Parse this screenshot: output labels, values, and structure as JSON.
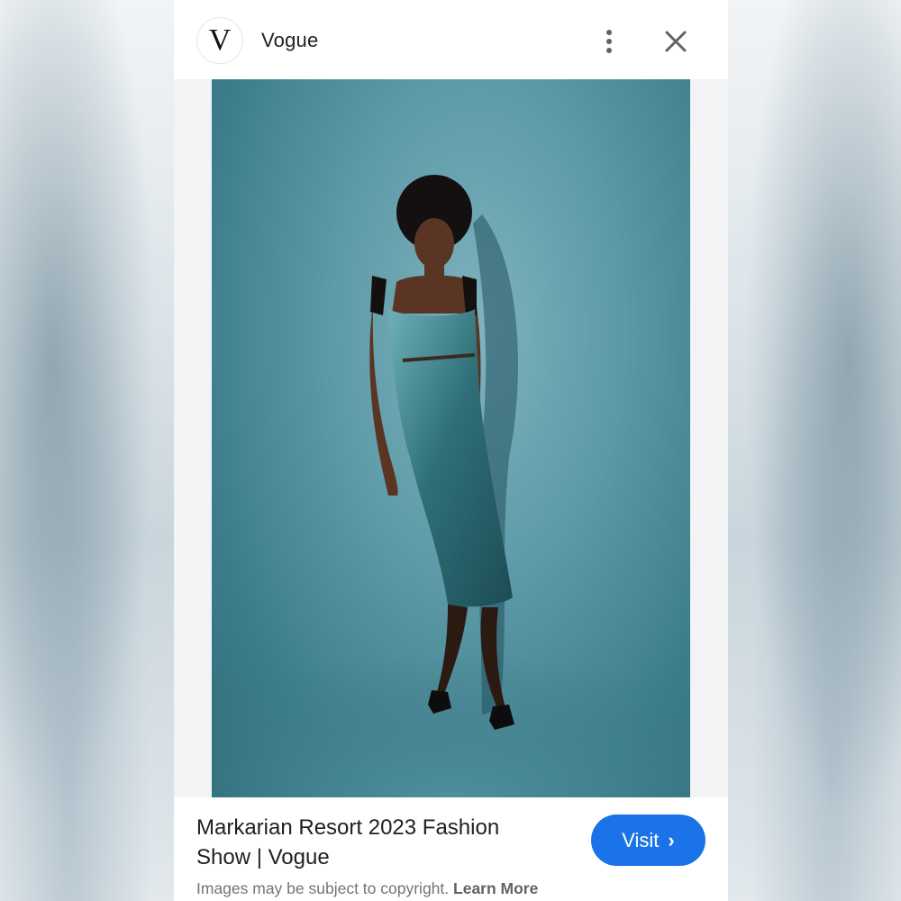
{
  "header": {
    "logo_letter": "V",
    "source_name": "Vogue",
    "more_icon": "more-vert-icon",
    "close_icon": "close-icon"
  },
  "image": {
    "alt": "Markarian Resort 2023 Fashion Show | Vogue"
  },
  "footer": {
    "caption": "Markarian Resort 2023 Fashion Show | Vogue",
    "visit_label": "Visit",
    "visit_icon": "chevron-right-icon",
    "copyright_text": "Images may be subject to copyright.",
    "learn_more_label": "Learn More"
  },
  "colors": {
    "accent": "#1a73e8",
    "photo_background": "#5e9aa7"
  }
}
